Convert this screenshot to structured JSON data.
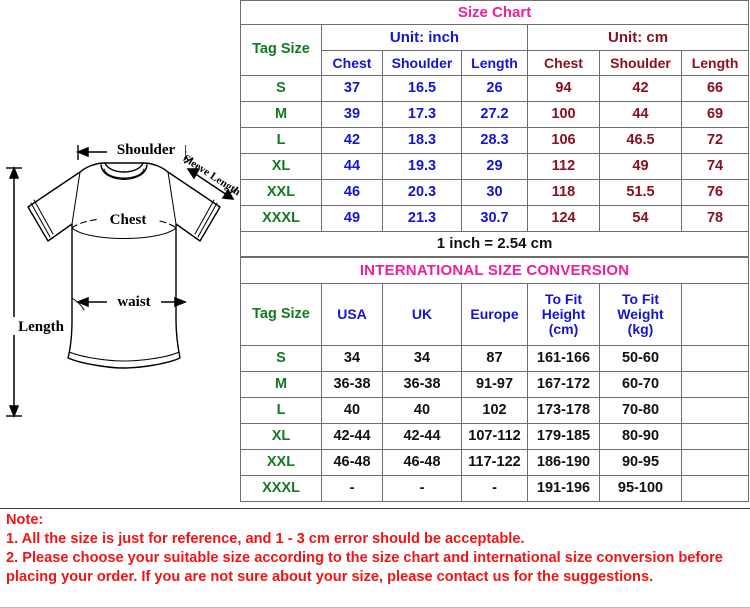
{
  "diagram": {
    "name": "tshirt-measurement-diagram",
    "labels": {
      "shoulder": "Shoulder",
      "sleeve_length": "Sleeve Length",
      "chest": "Chest",
      "length": "Length",
      "waist": "waist"
    }
  },
  "size_chart": {
    "title": "Size Chart",
    "tag_size_header": "Tag Size",
    "unit_groups": [
      {
        "label": "Unit: inch",
        "columns": [
          "Chest",
          "Shoulder",
          "Length"
        ]
      },
      {
        "label": "Unit: cm",
        "columns": [
          "Chest",
          "Shoulder",
          "Length"
        ]
      }
    ],
    "rows": [
      {
        "size": "S",
        "inch": [
          "37",
          "16.5",
          "26"
        ],
        "cm": [
          "94",
          "42",
          "66"
        ]
      },
      {
        "size": "M",
        "inch": [
          "39",
          "17.3",
          "27.2"
        ],
        "cm": [
          "100",
          "44",
          "69"
        ]
      },
      {
        "size": "L",
        "inch": [
          "42",
          "18.3",
          "28.3"
        ],
        "cm": [
          "106",
          "46.5",
          "72"
        ]
      },
      {
        "size": "XL",
        "inch": [
          "44",
          "19.3",
          "29"
        ],
        "cm": [
          "112",
          "49",
          "74"
        ]
      },
      {
        "size": "XXL",
        "inch": [
          "46",
          "20.3",
          "30"
        ],
        "cm": [
          "118",
          "51.5",
          "76"
        ]
      },
      {
        "size": "XXXL",
        "inch": [
          "49",
          "21.3",
          "30.7"
        ],
        "cm": [
          "124",
          "54",
          "78"
        ]
      }
    ],
    "conversion_note": "1 inch = 2.54 cm"
  },
  "international_conversion": {
    "title": "INTERNATIONAL SIZE CONVERSION",
    "headers": [
      "Tag Size",
      "USA",
      "UK",
      "Europe",
      "To Fit Height (cm)",
      "To Fit Weight (kg)",
      ""
    ],
    "headers_display": {
      "tag_size": "Tag Size",
      "usa": "USA",
      "uk": "UK",
      "europe": "Europe",
      "height_line1": "To Fit",
      "height_line2": "Height",
      "height_line3": "(cm)",
      "weight_line1": "To Fit",
      "weight_line2": "Weight",
      "weight_line3": "(kg)",
      "blank": ""
    },
    "rows": [
      {
        "size": "S",
        "usa": "34",
        "uk": "34",
        "europe": "87",
        "height": "161-166",
        "weight": "50-60",
        "extra": ""
      },
      {
        "size": "M",
        "usa": "36-38",
        "uk": "36-38",
        "europe": "91-97",
        "height": "167-172",
        "weight": "60-70",
        "extra": ""
      },
      {
        "size": "L",
        "usa": "40",
        "uk": "40",
        "europe": "102",
        "height": "173-178",
        "weight": "70-80",
        "extra": ""
      },
      {
        "size": "XL",
        "usa": "42-44",
        "uk": "42-44",
        "europe": "107-112",
        "height": "179-185",
        "weight": "80-90",
        "extra": ""
      },
      {
        "size": "XXL",
        "usa": "46-48",
        "uk": "46-48",
        "europe": "117-122",
        "height": "186-190",
        "weight": "90-95",
        "extra": ""
      },
      {
        "size": "XXXL",
        "usa": "-",
        "uk": "-",
        "europe": "-",
        "height": "191-196",
        "weight": "95-100",
        "extra": ""
      }
    ]
  },
  "note": {
    "heading": "Note:",
    "line1": "1. All the size is just for reference, and 1 - 3 cm error should be acceptable.",
    "line2": "2. Please choose your suitable size according to the size chart and international size conversion before placing your order. If you are not sure about your size, please contact us for the suggestions."
  },
  "colors": {
    "title_pink": "#ee1e9c",
    "tag_green": "#127a20",
    "inch_blue": "#1414d2",
    "cm_maroon": "#8a1020",
    "note_red": "#f01414",
    "black": "#111111",
    "border_gray": "#6e6e6e"
  }
}
